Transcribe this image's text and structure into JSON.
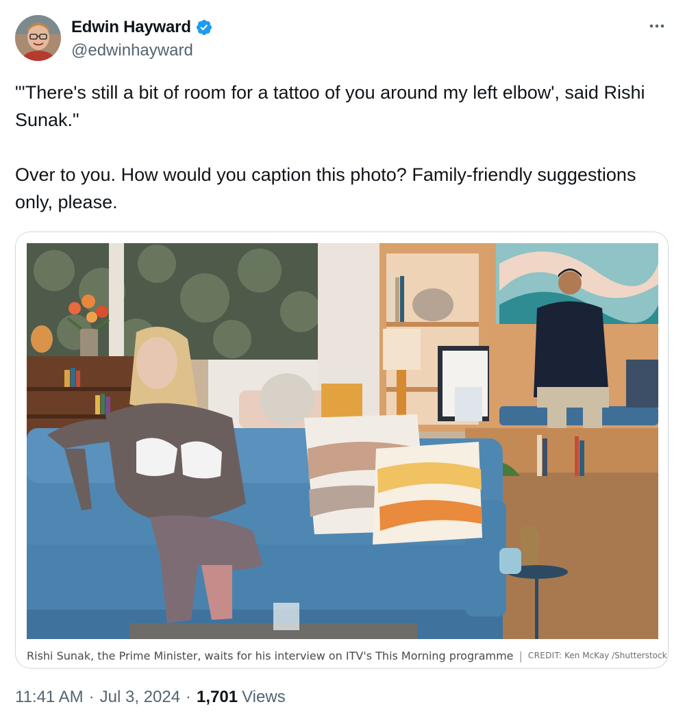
{
  "author": {
    "display_name": "Edwin Hayward",
    "handle": "@edwinhayward",
    "verified": true,
    "avatar_icon": "avatar-photo"
  },
  "tweet": {
    "text": "\"'There's still a bit of room for a tattoo of you around my left elbow', said Rishi Sunak.\"\n\nOver to you. How would you caption this photo? Family-friendly suggestions only, please."
  },
  "media": {
    "caption": "Rishi Sunak, the Prime Minister, waits for his interview on ITV's This Morning programme",
    "separator": "|",
    "credit_label": "CREDIT:",
    "credit_name": "Ken McKay /Shutterstock"
  },
  "meta": {
    "time": "11:41 AM",
    "date": "Jul 3, 2024",
    "views_count": "1,701",
    "views_label": "Views",
    "dot": "·"
  },
  "icons": {
    "verified": "verified-badge-icon",
    "more": "more-options-icon"
  },
  "colors": {
    "verified_blue": "#1d9bf0",
    "text_primary": "#0f1419",
    "text_secondary": "#536471",
    "border": "#cfd9de"
  }
}
